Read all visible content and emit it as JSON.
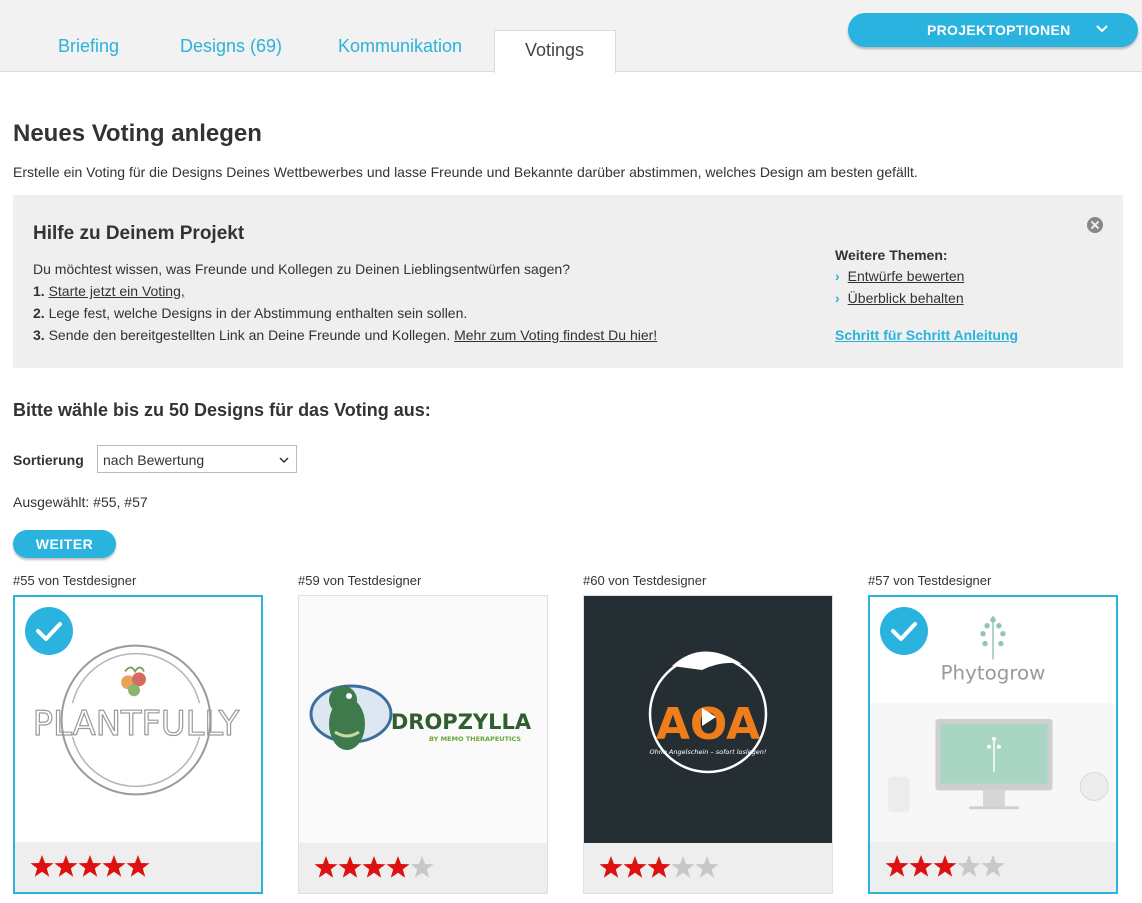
{
  "tabs": [
    {
      "label": "Briefing"
    },
    {
      "label": "Designs (69)"
    },
    {
      "label": "Kommunikation"
    },
    {
      "label": "Votings"
    }
  ],
  "project_options_label": "PROJEKTOPTIONEN",
  "page_title": "Neues Voting anlegen",
  "intro_text": "Erstelle ein Voting für die Designs Deines Wettbewerbes und lasse Freunde und Bekannte darüber abstimmen, welches Design am besten gefällt.",
  "help": {
    "title": "Hilfe zu Deinem Projekt",
    "question": "Du möchtest wissen, was Freunde und Kollegen zu Deinen Lieblingsentwürfen sagen?",
    "step1_num": "1.",
    "step1_link": "Starte jetzt ein Voting,",
    "step2_num": "2.",
    "step2_text": "Lege fest, welche Designs in der Abstimmung enthalten sein sollen.",
    "step3_num": "3.",
    "step3_text": "Sende den bereitgestellten Link an Deine Freunde und Kollegen.",
    "step3_link": "Mehr zum Voting findest Du hier!",
    "more_title": "Weitere Themen:",
    "more_items": [
      "Entwürfe bewerten",
      "Überblick behalten"
    ],
    "guide_link": "Schritt für Schritt Anleitung"
  },
  "pick_heading": "Bitte wähle bis zu 50 Designs für das Voting aus:",
  "sort_label": "Sortierung",
  "sort_value": "nach Bewertung",
  "selected_text": "Ausgewählt: #55, #57",
  "weiter_label": "WEITER",
  "designs": [
    {
      "caption": "#55 von Testdesigner",
      "rating": 5,
      "selected": true,
      "logo_text": "PLANTFULLY"
    },
    {
      "caption": "#59 von Testdesigner",
      "rating": 4,
      "selected": false,
      "logo_text": "DROPZYLLA",
      "logo_sub": "BY MEMO THERAPEUTICS"
    },
    {
      "caption": "#60 von Testdesigner",
      "rating": 3,
      "selected": false,
      "logo_text": "AOA",
      "logo_sub": "Ohne Angelschein – sofort loslegen!"
    },
    {
      "caption": "#57 von Testdesigner",
      "rating": 3,
      "selected": true,
      "logo_text": "Phytogrow"
    }
  ],
  "colors": {
    "accent": "#2bb3e0",
    "star_on": "#dd1111",
    "star_off": "#c8c8c8"
  }
}
